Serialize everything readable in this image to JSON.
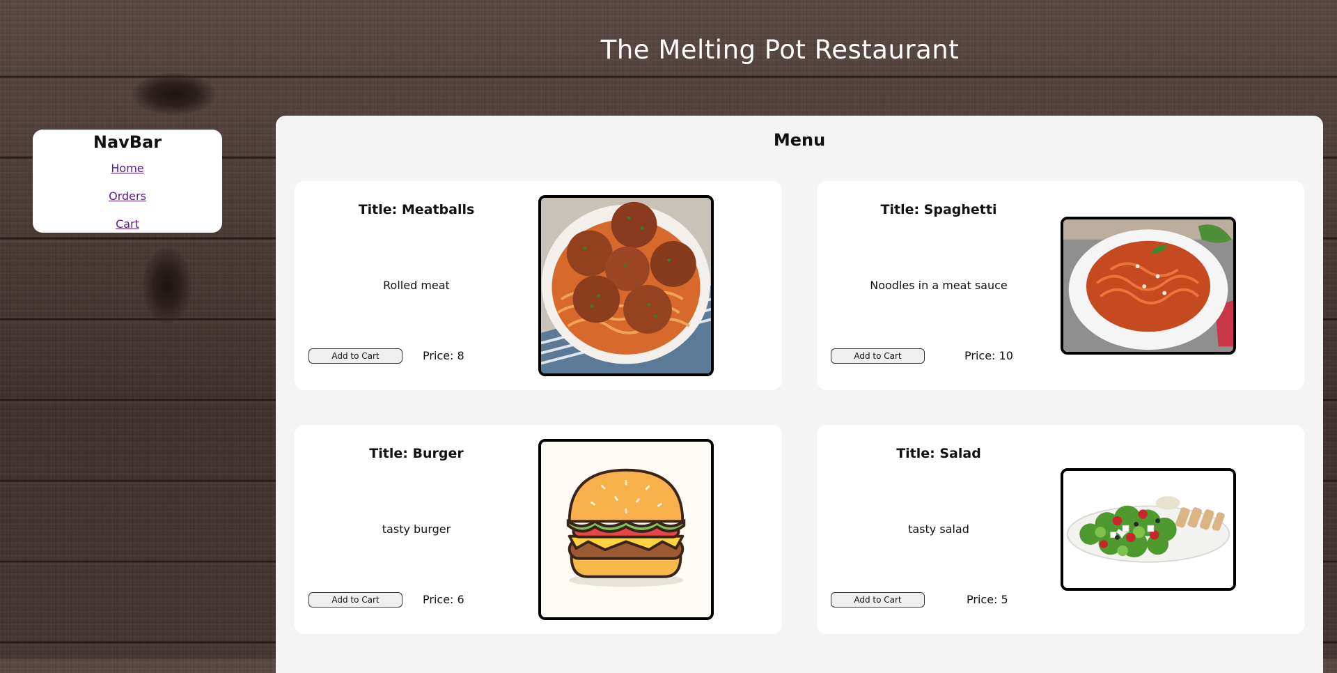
{
  "header": {
    "title": "The Melting Pot Restaurant"
  },
  "navbar": {
    "title": "NavBar",
    "links": [
      {
        "label": "Home"
      },
      {
        "label": "Orders"
      },
      {
        "label": "Cart"
      }
    ]
  },
  "menu": {
    "title": "Menu",
    "items": [
      {
        "title": "Title: Meatballs",
        "description": "Rolled meat",
        "button": "Add to Cart",
        "price": "Price: 8",
        "image": "meatballs-spaghetti-photo"
      },
      {
        "title": "Title: Spaghetti",
        "description": "Noodles in a meat sauce",
        "button": "Add to Cart",
        "price": "Price: 10",
        "image": "spaghetti-bowl-photo"
      },
      {
        "title": "Title: Burger",
        "description": "tasty burger",
        "button": "Add to Cart",
        "price": "Price: 6",
        "image": "burger-illustration"
      },
      {
        "title": "Title: Salad",
        "description": "tasty salad",
        "button": "Add to Cart",
        "price": "Price: 5",
        "image": "salad-plate-photo"
      }
    ]
  }
}
